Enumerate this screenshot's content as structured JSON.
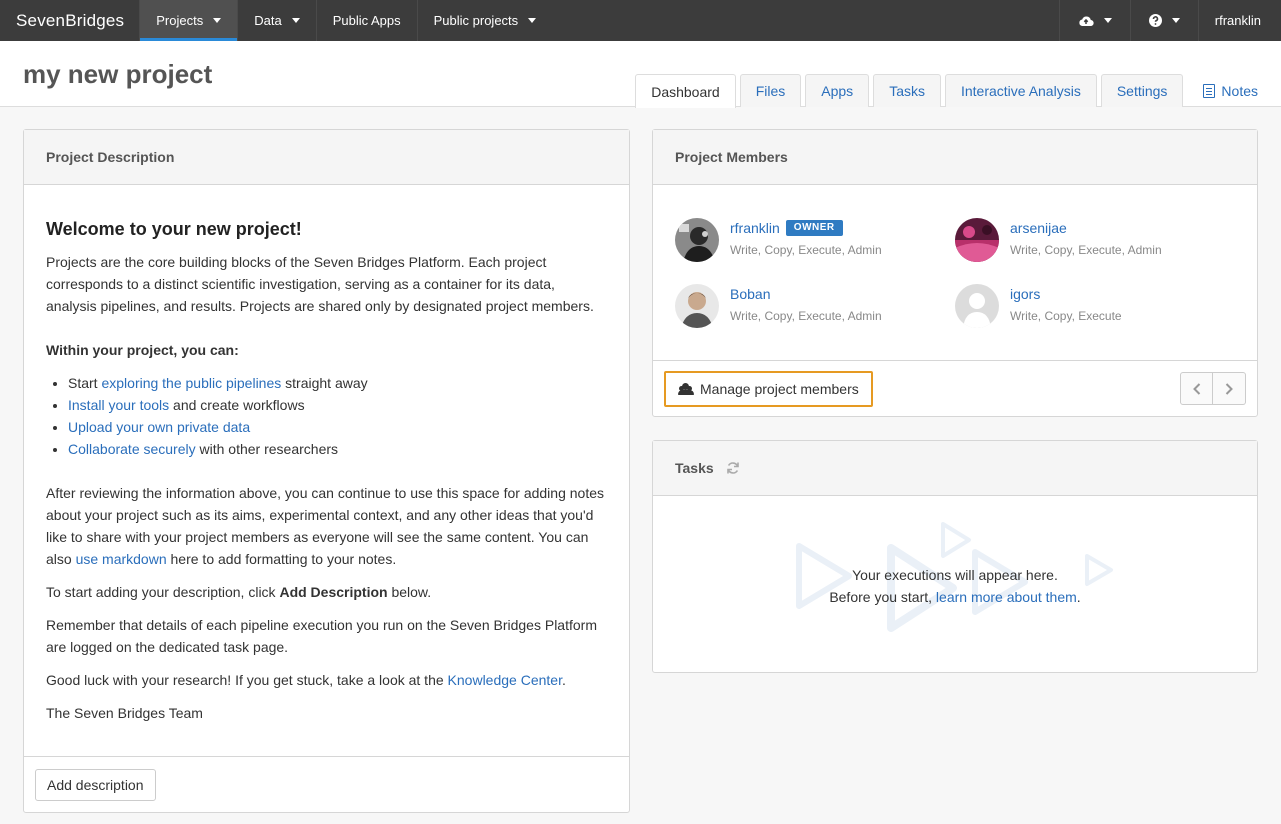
{
  "nav": {
    "brand": "SevenBridges",
    "items": [
      {
        "label": "Projects",
        "dropdown": true,
        "active": true
      },
      {
        "label": "Data",
        "dropdown": true
      },
      {
        "label": "Public Apps",
        "dropdown": false
      },
      {
        "label": "Public projects",
        "dropdown": true
      }
    ],
    "user": "rfranklin",
    "upload_icon": "cloud-upload-icon",
    "help_icon": "question-circle-icon"
  },
  "project": {
    "title": "my new project",
    "tabs": [
      "Dashboard",
      "Files",
      "Apps",
      "Tasks",
      "Interactive Analysis",
      "Settings"
    ],
    "active_tab": "Dashboard",
    "notes_label": "Notes"
  },
  "description": {
    "heading": "Project Description",
    "welcome": "Welcome to your new project!",
    "intro": "Projects are the core building blocks of the Seven Bridges Platform. Each project corresponds to a distinct scientific investigation, serving as a container for its data, analysis pipelines, and results. Projects are shared only by designated project members.",
    "within": "Within your project, you can:",
    "list": [
      {
        "pre": "Start ",
        "link": "exploring the public pipelines",
        "post": " straight away"
      },
      {
        "pre": "",
        "link": "Install your tools",
        "post": " and create workflows"
      },
      {
        "pre": "",
        "link": "Upload your own private data",
        "post": ""
      },
      {
        "pre": "",
        "link": "Collaborate securely",
        "post": " with other researchers"
      }
    ],
    "after_pre": "After reviewing the information above, you can continue to use this space for adding notes about your project such as its aims, experimental context, and any other ideas that you'd like to share with your project members as everyone will see the same content. You can also ",
    "after_link": "use markdown",
    "after_post": " here to add formatting to your notes.",
    "start_pre": "To start adding your description, click ",
    "start_bold": "Add Description",
    "start_post": " below.",
    "remember": "Remember that details of each pipeline execution you run on the Seven Bridges Platform are logged on the dedicated task page.",
    "luck_pre": "Good luck with your research! If you get stuck, take a look at the ",
    "luck_link": "Knowledge Center",
    "luck_post": ".",
    "signoff": "The Seven Bridges Team",
    "add_button": "Add description"
  },
  "members": {
    "heading": "Project Members",
    "list": [
      {
        "name": "rfranklin",
        "badge": "OWNER",
        "perms": "Write, Copy, Execute, Admin"
      },
      {
        "name": "arsenijae",
        "badge": "",
        "perms": "Write, Copy, Execute, Admin"
      },
      {
        "name": "Boban",
        "badge": "",
        "perms": "Write, Copy, Execute, Admin"
      },
      {
        "name": "igors",
        "badge": "",
        "perms": "Write, Copy, Execute"
      }
    ],
    "manage_button": "Manage project members",
    "prev_icon": "chevron-left-icon",
    "next_icon": "chevron-right-icon"
  },
  "tasks": {
    "heading": "Tasks",
    "line1": "Your executions will appear here.",
    "line2_pre": "Before you start, ",
    "line2_link": "learn more about them",
    "line2_post": "."
  },
  "colors": {
    "accent": "#2a6ebb",
    "highlight": "#e69a22",
    "nav_bg": "#3c3c3c",
    "owner_badge": "#2f7bc2"
  }
}
